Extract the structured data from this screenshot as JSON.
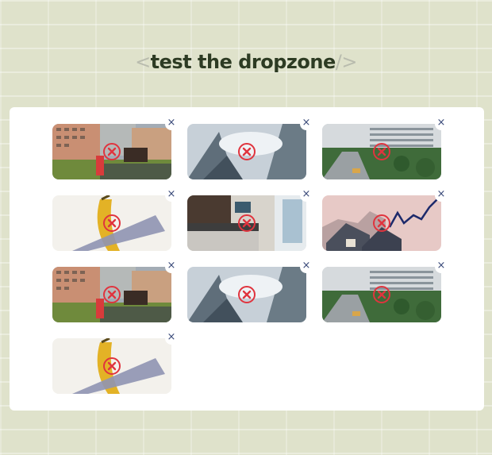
{
  "title": {
    "open": "<",
    "text": "test the dropzone",
    "close": "/>"
  },
  "dropzone": {
    "accent": "#e0343e",
    "close_glyph": "×",
    "files": [
      {
        "thumb": "apartment-complex-playground"
      },
      {
        "thumb": "glass-skyscraper"
      },
      {
        "thumb": "residential-street-tower"
      },
      {
        "thumb": "banana-taped"
      },
      {
        "thumb": "modern-kitchen-interior"
      },
      {
        "thumb": "houses-rising-chart"
      },
      {
        "thumb": "apartment-complex-playground"
      },
      {
        "thumb": "glass-skyscraper"
      },
      {
        "thumb": "residential-street-tower"
      },
      {
        "thumb": "banana-taped"
      }
    ]
  }
}
